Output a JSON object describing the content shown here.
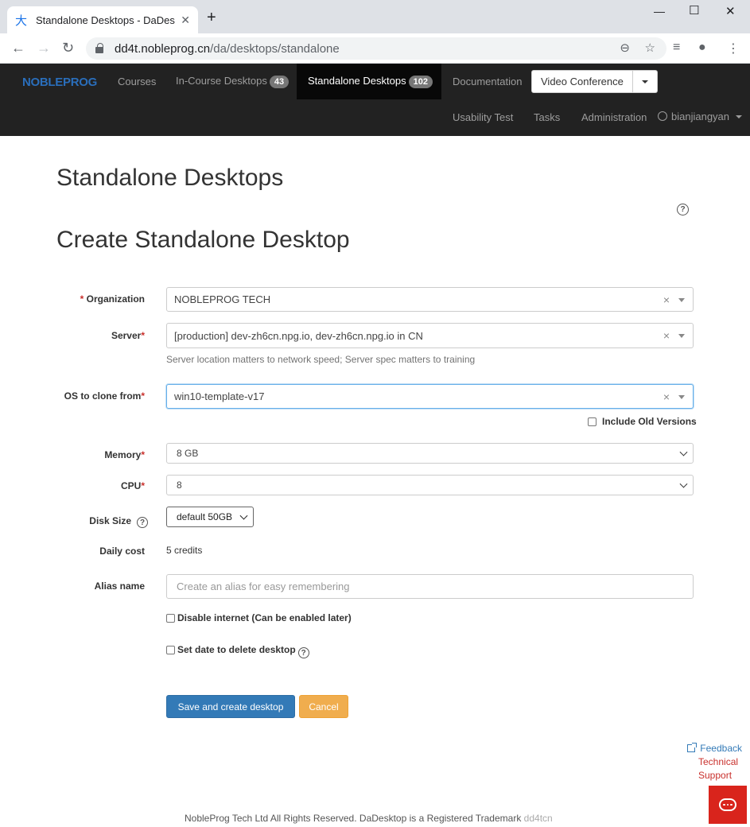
{
  "browser": {
    "tab_title": "Standalone Desktops - DaDesktop",
    "tab_favicon": "大",
    "url_host": "dd4t.nobleprog.cn",
    "url_path": "/da/desktops/standalone"
  },
  "navbar": {
    "brand": "NOBLEPROG",
    "courses": "Courses",
    "in_course": "In-Course Desktops",
    "in_course_count": "43",
    "standalone": "Standalone Desktops",
    "standalone_count": "102",
    "documentation": "Documentation",
    "video_conference": "Video Conference",
    "usability_test": "Usability Test",
    "tasks": "Tasks",
    "administration": "Administration",
    "username": "bianjiangyan"
  },
  "page": {
    "title": "Standalone Desktops",
    "form_title": "Create Standalone Desktop"
  },
  "form": {
    "organization_label": "Organization",
    "organization_value": "NOBLEPROG TECH",
    "server_label": "Server",
    "server_value": "[production] dev-zh6cn.npg.io, dev-zh6cn.npg.io in CN",
    "server_help": "Server location matters to network speed; Server spec matters to training",
    "os_label": "OS to clone from",
    "os_value": "win10-template-v17",
    "include_old": "Include Old Versions",
    "memory_label": "Memory",
    "memory_value": "8 GB",
    "cpu_label": "CPU",
    "cpu_value": "8",
    "disk_label": "Disk Size",
    "disk_value": "default 50GB",
    "cost_label": "Daily cost",
    "cost_value": "5 credits",
    "alias_label": "Alias name",
    "alias_placeholder": "Create an alias for easy remembering",
    "disable_internet": "Disable internet (Can be enabled later)",
    "set_delete_date": "Set date to delete desktop",
    "required_mark": "*",
    "save_button": "Save and create desktop",
    "cancel_button": "Cancel"
  },
  "side": {
    "feedback": "Feedback",
    "technical_support": "Technical Support"
  },
  "footer": {
    "text": "NobleProg Tech Ltd All Rights Reserved. DaDesktop is a Registered Trademark",
    "tag": "dd4tcn"
  },
  "colors": {
    "navbar_bg": "#222222",
    "primary": "#337ab7",
    "warning": "#f0ad4e",
    "chat": "#d9241c"
  }
}
